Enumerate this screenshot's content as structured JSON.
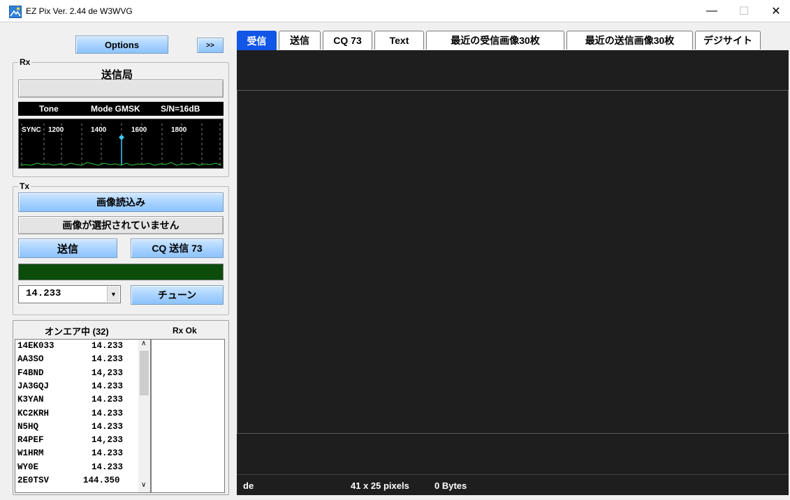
{
  "window": {
    "title": "EZ Pix   Ver. 2.44 de W3WVG",
    "minimize_glyph": "—",
    "maximize_glyph": "☐",
    "close_glyph": "✕"
  },
  "toolbar": {
    "options_label": "Options",
    "expand_label": ">>"
  },
  "rx": {
    "group_label": "Rx",
    "station_label": "送信局",
    "station_value": "",
    "status": {
      "tone": "Tone",
      "mode": "Mode GMSK",
      "snr": "S/N=16dB"
    },
    "spectrum_labels": [
      "SYNC",
      "1200",
      "1400",
      "1600",
      "1800"
    ]
  },
  "tx": {
    "group_label": "Tx",
    "load_image_label": "画像読込み",
    "no_image_label": "画像が選択されていません",
    "send_label": "送信",
    "cq_send_label": "CQ  送信  73",
    "progress": 1.0,
    "frequency": "14.233",
    "tune_label": "チューン"
  },
  "onair": {
    "header_label": "オンエア中 (32)",
    "rxok_label": "Rx Ok",
    "stations": [
      {
        "call": "14EK033",
        "freq": "14.233"
      },
      {
        "call": "AA3SO",
        "freq": "14.233"
      },
      {
        "call": "F4BND",
        "freq": "14,233"
      },
      {
        "call": "JA3GQJ",
        "freq": "14.233"
      },
      {
        "call": "K3YAN",
        "freq": "14.233"
      },
      {
        "call": "KC2KRH",
        "freq": "14.233"
      },
      {
        "call": "N5HQ",
        "freq": "14.233"
      },
      {
        "call": "R4PEF",
        "freq": "14,233"
      },
      {
        "call": "W1HRM",
        "freq": "14.233"
      },
      {
        "call": "WY0E",
        "freq": "14.233"
      },
      {
        "call": "2E0TSV",
        "freq": "144.350"
      }
    ]
  },
  "tabs": [
    "受信",
    "送信",
    "CQ 73",
    "Text",
    "最近の受信画像30枚",
    "最近の送信画像30枚",
    "デジサイト"
  ],
  "status": {
    "de": "de",
    "pixels": "41 x 25 pixels",
    "bytes": "0 Bytes"
  },
  "colors": {
    "active_tab": "#1256e8",
    "panel_bg": "#1e1e1e",
    "progress": "#0c4d0c",
    "spectrum_marker": "#3ec8ff",
    "spectrum_noise": "#2ecc40"
  }
}
